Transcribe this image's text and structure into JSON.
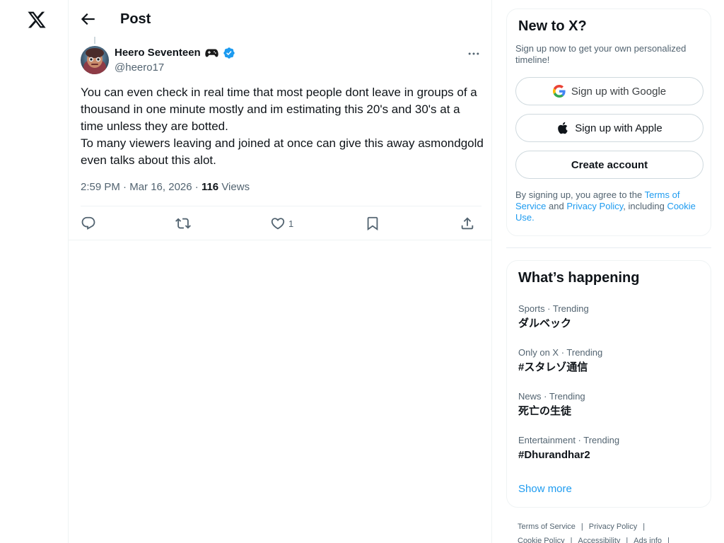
{
  "header": {
    "title": "Post"
  },
  "post": {
    "author_name": "Heero Seventeen",
    "author_handle": "@heero17",
    "text_lines": [
      "You can even check in real time that most people dont leave in groups of a thousand in one minute mostly and im estimating this 20's and 30's at a time unless they are botted.",
      "To many viewers leaving and joined at once can give this away asmondgold even talks about this alot."
    ],
    "time": "2:59 PM",
    "date": "Mar 16, 2026",
    "meta_sep": "·",
    "views_count": "116",
    "views_label": "Views",
    "likes_count": "1"
  },
  "signup": {
    "title": "New to X?",
    "subtitle": "Sign up now to get your own personalized timeline!",
    "google_label": "Sign up with Google",
    "apple_label": "Sign up with Apple",
    "create_label": "Create account",
    "terms_prefix": "By signing up, you agree to the",
    "terms_link": "Terms of Service",
    "terms_and": "and",
    "privacy_link": "Privacy Policy",
    "terms_including": ", including",
    "cookie_link": "Cookie Use",
    "terms_end": "."
  },
  "trends": {
    "title": "What’s happening",
    "items": [
      {
        "meta": "Sports · Trending",
        "name": "ダルベック"
      },
      {
        "meta": "Only on X · Trending",
        "name": "#スタレゾ通信"
      },
      {
        "meta": "News · Trending",
        "name": "死亡の生徒"
      },
      {
        "meta": "Entertainment · Trending",
        "name": "#Dhurandhar2"
      }
    ],
    "show_more": "Show more"
  },
  "footer": {
    "row1": [
      "Terms of Service",
      "Privacy Policy"
    ],
    "row2": [
      "Cookie Policy",
      "Accessibility",
      "Ads info"
    ],
    "sep": "|"
  },
  "colors": {
    "accent": "#1d9bf0",
    "text": "#0f1419",
    "secondary_text": "#536471",
    "border": "#eff3f4"
  },
  "icons": {
    "logo": "x-logo-icon",
    "back": "arrow-left-icon",
    "more": "more-horizontal-icon",
    "reply": "reply-icon",
    "repost": "repost-icon",
    "like": "heart-icon",
    "bookmark": "bookmark-icon",
    "share": "share-icon",
    "verified": "verified-badge-icon",
    "gamepad": "gamepad-icon",
    "google": "google-icon",
    "apple": "apple-icon"
  }
}
